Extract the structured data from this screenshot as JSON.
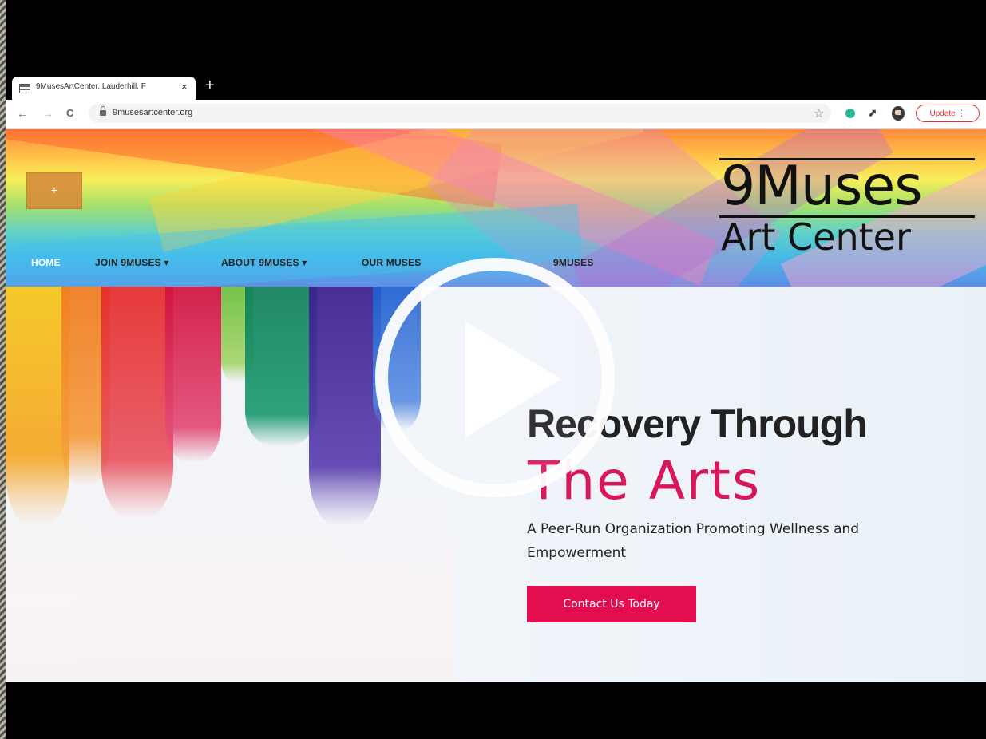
{
  "browser": {
    "tab_title": "9MusesArtCenter, Lauderhill, F",
    "tab_close": "×",
    "new_tab": "+",
    "back": "←",
    "forward": "→",
    "reload": "C",
    "url": "9musesartcenter.org",
    "star": "☆",
    "extension_pin": "⬈",
    "update_label": "Update"
  },
  "site": {
    "toggle_symbol": "+",
    "logo_line1": "9Muses",
    "logo_line2": "Art Center",
    "menu": [
      {
        "label": "HOME"
      },
      {
        "label": "JOIN 9MUSES ▾"
      },
      {
        "label": "ABOUT 9MUSES ▾"
      },
      {
        "label": "OUR MUSES"
      },
      {
        "label": "9MUSES"
      }
    ]
  },
  "hero": {
    "title": "Recovery Through",
    "title_accent": "The Arts",
    "tagline": "A Peer-Run Organization Promoting Wellness and Empowerment",
    "cta": "Contact Us Today"
  },
  "colors": {
    "accent": "#e40d4f",
    "title_accent": "#d8175a",
    "update": "#e3342f"
  },
  "overlay": {
    "icon": "play-icon"
  }
}
